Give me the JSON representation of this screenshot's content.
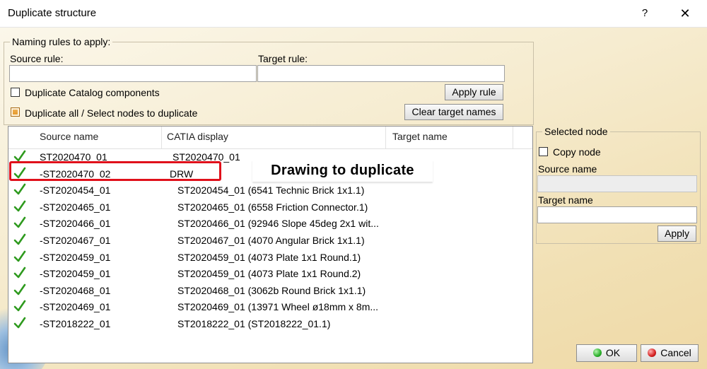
{
  "window": {
    "title": "Duplicate structure",
    "help_label": "?",
    "close_label": "✕"
  },
  "naming": {
    "legend": "Naming rules to apply:",
    "source_rule_label": "Source rule:",
    "source_rule_value": "",
    "target_rule_label": "Target rule:",
    "target_rule_value": "",
    "catalog_label": "Duplicate Catalog components",
    "catalog_checked": false,
    "dup_all_label": "Duplicate all / Select nodes to duplicate",
    "dup_all_checked": true,
    "apply_rule_label": "Apply rule",
    "clear_target_label": "Clear target names"
  },
  "table": {
    "columns": [
      "Source name",
      "CATIA display",
      "Target name"
    ],
    "rows": [
      {
        "source": "ST2020470_01",
        "display": "ST2020470_01",
        "target": ""
      },
      {
        "source": "-ST2020470_02",
        "display": "DRW",
        "target": ""
      },
      {
        "source": "-ST2020454_01",
        "display": "ST2020454_01 (6541 Technic Brick 1x1.1)",
        "target": ""
      },
      {
        "source": "-ST2020465_01",
        "display": "ST2020465_01 (6558 Friction Connector.1)",
        "target": ""
      },
      {
        "source": "-ST2020466_01",
        "display": "ST2020466_01 (92946 Slope 45deg 2x1 wit...",
        "target": ""
      },
      {
        "source": "-ST2020467_01",
        "display": "ST2020467_01 (4070 Angular Brick 1x1.1)",
        "target": ""
      },
      {
        "source": "-ST2020459_01",
        "display": "ST2020459_01 (4073 Plate 1x1 Round.1)",
        "target": ""
      },
      {
        "source": "-ST2020459_01",
        "display": "ST2020459_01 (4073 Plate 1x1 Round.2)",
        "target": ""
      },
      {
        "source": "-ST2020468_01",
        "display": "ST2020468_01 (3062b Round Brick 1x1.1)",
        "target": ""
      },
      {
        "source": "-ST2020469_01",
        "display": "ST2020469_01 (13971 Wheel ø18mm x 8m...",
        "target": ""
      },
      {
        "source": "-ST2018222_01",
        "display": "ST2018222_01 (ST2018222_01.1)",
        "target": ""
      }
    ]
  },
  "annotation": {
    "text": "Drawing to duplicate"
  },
  "selected_node": {
    "legend": "Selected node",
    "copy_label": "Copy node",
    "copy_checked": false,
    "source_name_label": "Source name",
    "source_name_value": "",
    "target_name_label": "Target name",
    "target_name_value": "",
    "apply_label": "Apply"
  },
  "footer": {
    "ok_label": "OK",
    "cancel_label": "Cancel"
  },
  "colors": {
    "check": "#2e9a1e",
    "annotation_border": "#e0101b",
    "ok_dot": "#2bb02b",
    "cancel_dot": "#d62020"
  },
  "icons": {
    "row_status": "check-icon",
    "ok": "green-dot-icon",
    "cancel": "red-dot-icon"
  }
}
